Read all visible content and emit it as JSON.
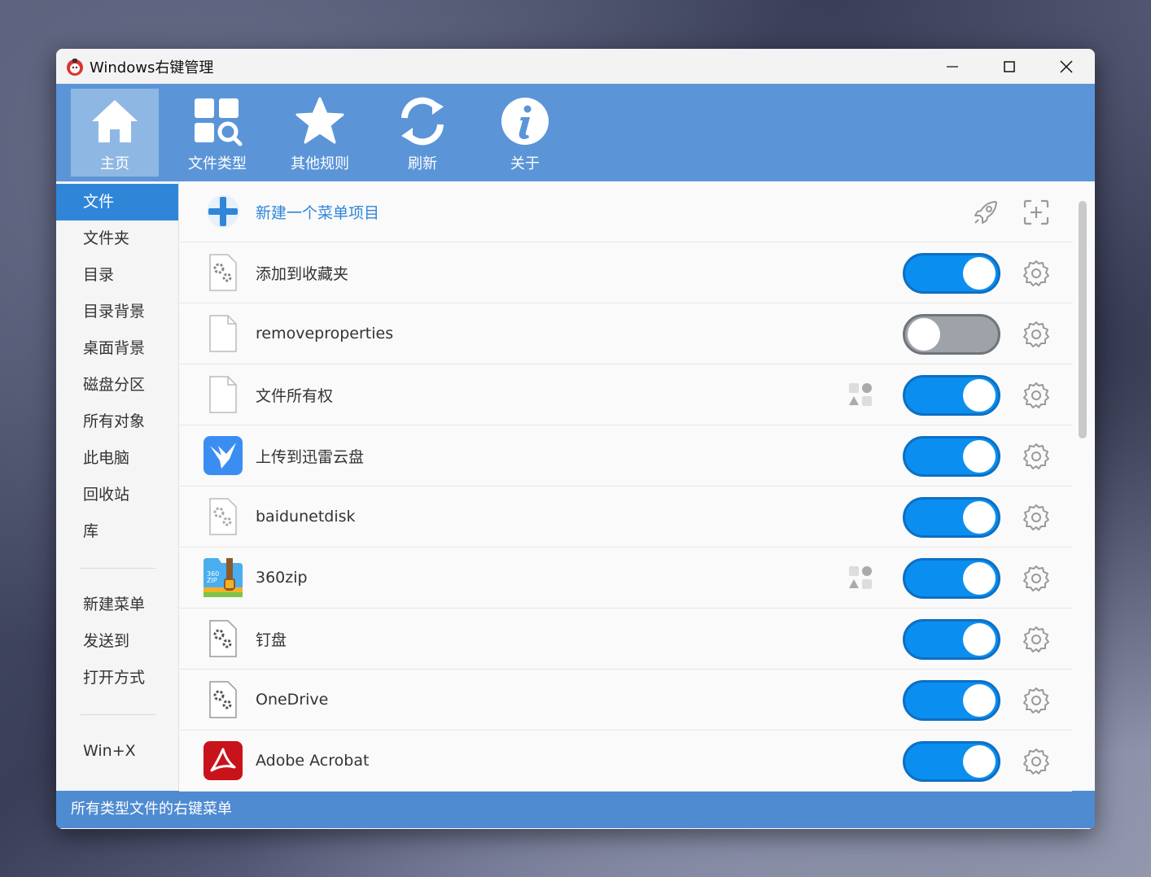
{
  "window": {
    "title": "Windows右键管理"
  },
  "toolbar": {
    "items": [
      {
        "label": "主页",
        "icon": "home-icon",
        "active": true
      },
      {
        "label": "文件类型",
        "icon": "file-types-icon"
      },
      {
        "label": "其他规则",
        "icon": "star-icon"
      },
      {
        "label": "刷新",
        "icon": "refresh-icon"
      },
      {
        "label": "关于",
        "icon": "info-icon"
      }
    ]
  },
  "sidebar": {
    "items": [
      "文件",
      "文件夹",
      "目录",
      "目录背景",
      "桌面背景",
      "磁盘分区",
      "所有对象",
      "此电脑",
      "回收站",
      "库"
    ],
    "items2": [
      "新建菜单",
      "发送到",
      "打开方式"
    ],
    "items3": [
      "Win+X"
    ]
  },
  "content": {
    "new_item_label": "新建一个菜单项目",
    "rows": [
      {
        "label": "添加到收藏夹",
        "icon": "gear-file-icon",
        "enabled": true
      },
      {
        "label": "removeproperties",
        "icon": "blank-file-icon",
        "enabled": false
      },
      {
        "label": "文件所有权",
        "icon": "blank-file-icon",
        "enabled": true,
        "tag": true
      },
      {
        "label": "上传到迅雷云盘",
        "icon": "thunder-bird-icon",
        "enabled": true
      },
      {
        "label": "baidunetdisk",
        "icon": "gear-file-icon",
        "enabled": true
      },
      {
        "label": "360zip",
        "icon": "zip-icon",
        "enabled": true,
        "tag": true
      },
      {
        "label": "钉盘",
        "icon": "gear-file-icon",
        "enabled": true
      },
      {
        "label": "OneDrive",
        "icon": "gear-file-icon",
        "enabled": true
      },
      {
        "label": "Adobe Acrobat",
        "icon": "acrobat-icon",
        "enabled": true
      }
    ]
  },
  "statusbar": {
    "text": "所有类型文件的右键菜单"
  },
  "colors": {
    "toolbar": "#5b95d8",
    "accent": "#2f86d9",
    "toggle_on": "#0a8ff0",
    "toggle_off": "#9ea3a9"
  }
}
